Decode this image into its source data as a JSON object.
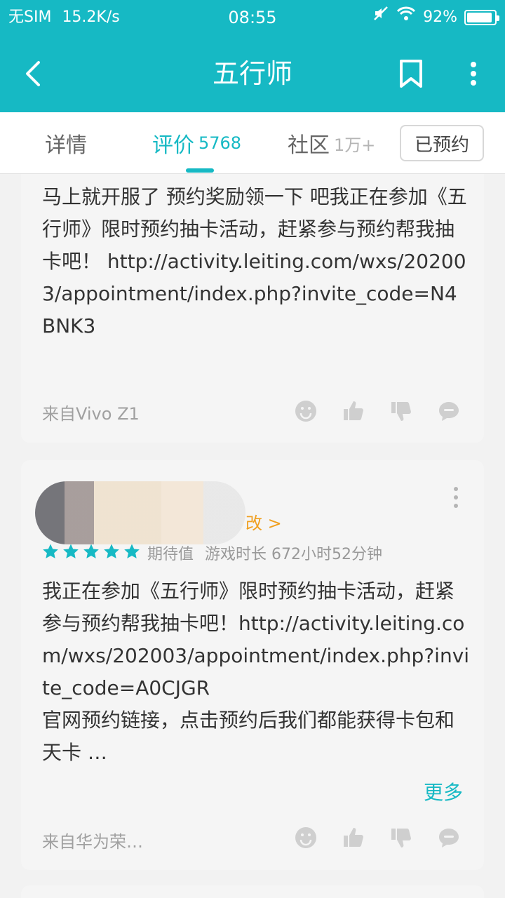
{
  "status": {
    "sim": "无SIM",
    "speed": "15.2K/s",
    "time": "08:55",
    "battery": "92%",
    "battery_level": 0.92
  },
  "header": {
    "title": "五行师"
  },
  "tabs": [
    {
      "label": "详情",
      "count": ""
    },
    {
      "label": "评价",
      "count": "5768"
    },
    {
      "label": "社区",
      "count": "1万+"
    }
  ],
  "reserve_button": "已预约",
  "reviews": [
    {
      "text": "马上就开服了 预约奖励领一下 吧我正在参加《五行师》限时预约抽卡活动，赶紧参与预约帮我抽卡吧！ http://activity.leiting.com/wxs/202003/appointment/index.php?invite_code=N4BNK3",
      "source": "来自Vivo Z1"
    },
    {
      "user_suffix": "改 >",
      "stars": 5,
      "expectation_label": "期待值",
      "play_time": "游戏时长 672小时52分钟",
      "text": "我正在参加《五行师》限时预约抽卡活动，赶紧参与预约帮我抽卡吧！http://activity.leiting.com/wxs/202003/appointment/index.php?invite_code=A0CJGR\n官网预约链接，点击预约后我们都能获得卡包和天卡 …",
      "more": "更多",
      "source": "来自华为荣…"
    }
  ],
  "colors": {
    "primary": "#16b9c4",
    "star": "#16b9c4",
    "user_link": "#f0a020"
  },
  "icons": {
    "back": "chevron-left-icon",
    "bookmark": "bookmark-icon",
    "more": "more-vertical-icon",
    "actions": [
      "emoji-icon",
      "thumb-up-icon",
      "thumb-down-icon",
      "comment-icon"
    ]
  }
}
